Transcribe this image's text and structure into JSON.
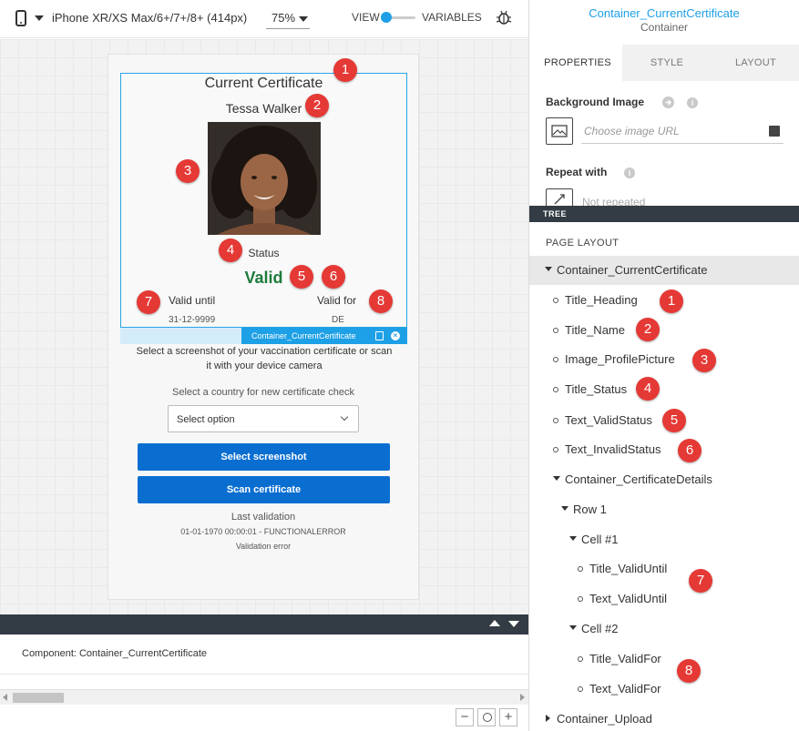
{
  "toolbar": {
    "device_label": "iPhone XR/XS Max/6+/7+/8+ (414px)",
    "zoom_label": "75%",
    "view_label": "VIEW",
    "variables_label": "VARIABLES"
  },
  "phone": {
    "certificate": {
      "title": "Current Certificate",
      "name": "Tessa Walker",
      "status_label": "Status",
      "status_value": "Valid",
      "valid_until_label": "Valid until",
      "valid_until_value": "31-12-9999",
      "valid_for_label": "Valid for",
      "valid_for_value": "DE"
    },
    "selection_tag": "Container_CurrentCertificate",
    "upload_description": "Select a screenshot of your vaccination certificate or scan it with your device camera",
    "country_label": "Select a country for new certificate check",
    "country_select_value": "Select option",
    "select_screenshot_button": "Select screenshot",
    "scan_certificate_button": "Scan certificate",
    "last_validation_label": "Last validation",
    "last_validation_value": "01-01-1970 00:00:01 - FUNCTIONALERROR",
    "validation_error": "Validation error"
  },
  "canvas_markers": [
    "1",
    "2",
    "3",
    "4",
    "5",
    "6",
    "7",
    "8"
  ],
  "component_panel": {
    "label": "Component: Container_CurrentCertificate",
    "zoom_out": "−",
    "zoom_in": "+"
  },
  "right_panel": {
    "title": "Container_CurrentCertificate",
    "subtitle": "Container",
    "tabs": [
      "PROPERTIES",
      "STYLE",
      "LAYOUT"
    ],
    "background_image_label": "Background Image",
    "image_url_placeholder": "Choose image URL",
    "repeat_with_label": "Repeat with",
    "repeat_value": "Not repeated",
    "info_icon_glyph": "i",
    "tree_header": "TREE",
    "page_layout_label": "PAGE LAYOUT",
    "tree": [
      {
        "label": "Container_CurrentCertificate",
        "marker": ""
      },
      {
        "label": "Title_Heading",
        "marker": "1"
      },
      {
        "label": "Title_Name",
        "marker": "2"
      },
      {
        "label": "Image_ProfilePicture",
        "marker": "3"
      },
      {
        "label": "Title_Status",
        "marker": "4"
      },
      {
        "label": "Text_ValidStatus",
        "marker": "5"
      },
      {
        "label": "Text_InvalidStatus",
        "marker": "6"
      },
      {
        "label": "Container_CertificateDetails",
        "marker": ""
      },
      {
        "label": "Row 1",
        "marker": ""
      },
      {
        "label": "Cell #1",
        "marker": ""
      },
      {
        "label": "Title_ValidUntil",
        "marker": ""
      },
      {
        "label": "Text_ValidUntil",
        "marker": ""
      },
      {
        "label": "Cell #2",
        "marker": ""
      },
      {
        "label": "Title_ValidFor",
        "marker": ""
      },
      {
        "label": "Text_ValidFor",
        "marker": ""
      },
      {
        "label": "Container_Upload",
        "marker": ""
      }
    ],
    "group_markers": [
      "7",
      "8"
    ]
  },
  "colors": {
    "accent": "#1ea0e6",
    "valid_green": "#1e7b3c",
    "button_blue": "#0a6ed1",
    "marker_red": "#e53935",
    "dark_bar": "#333b44"
  }
}
